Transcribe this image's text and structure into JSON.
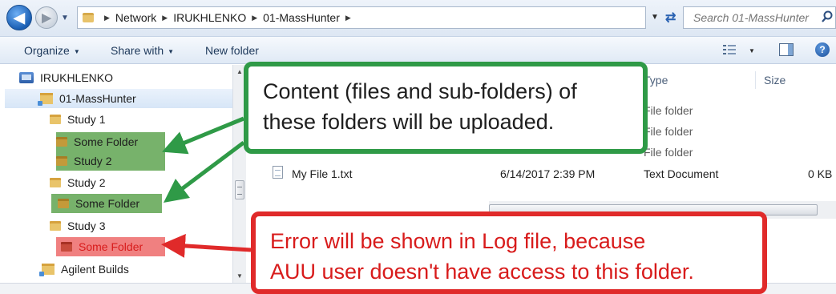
{
  "address_bar": {
    "breadcrumbs": [
      "Network",
      "IRUKHLENKO",
      "01-MassHunter"
    ],
    "search_placeholder": "Search 01-MassHunter"
  },
  "toolbar": {
    "organize_label": "Organize",
    "share_label": "Share with",
    "new_folder_label": "New folder"
  },
  "nav_tree": {
    "computer": "IRUKHLENKO",
    "share": "01-MassHunter",
    "study1": "Study 1",
    "study1_some_folder": "Some Folder",
    "study1_study2": "Study 2",
    "study2": "Study 2",
    "study2_some_folder": "Some Folder",
    "study3": "Study 3",
    "study3_some_folder": "Some Folder",
    "agilent_builds": "Agilent Builds"
  },
  "file_list": {
    "columns": {
      "type": "Type",
      "size": "Size"
    },
    "folder_type": "File folder",
    "file": {
      "name": "My File 1.txt",
      "date": "6/14/2017 2:39 PM",
      "type": "Text Document",
      "size": "0 KB"
    }
  },
  "callouts": {
    "green_line1": "Content (files and sub-folders) of",
    "green_line2": "these folders will be uploaded.",
    "red_line1": "Error will be shown in Log file, because",
    "red_line2": "AUU user doesn't have access to this folder."
  },
  "colors": {
    "green_highlight": "#77b26b",
    "green_callout": "#2f9a47",
    "red_highlight": "#f08080",
    "red_callout": "#e02a2a"
  }
}
